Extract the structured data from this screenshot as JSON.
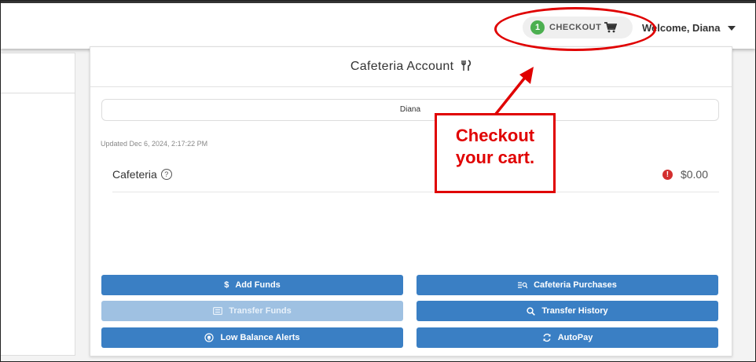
{
  "header": {
    "cart_count": "1",
    "checkout_label": "CHECKOUT",
    "welcome_text": "Welcome, Diana"
  },
  "card": {
    "title": "Cafeteria Account",
    "student_name": "Diana",
    "updated": "Updated Dec 6, 2024, 2:17:22 PM",
    "account": {
      "name": "Cafeteria",
      "help_glyph": "?",
      "alert_glyph": "!",
      "balance": "$0.00"
    },
    "buttons": {
      "add_funds": "Add Funds",
      "cafeteria_purchases": "Cafeteria Purchases",
      "transfer_funds": "Transfer Funds",
      "transfer_history": "Transfer History",
      "low_balance_alerts": "Low Balance Alerts",
      "autopay": "AutoPay"
    }
  },
  "annotation": {
    "callout_line1": "Checkout",
    "callout_line2": "your cart."
  },
  "colors": {
    "primary": "#3a7fc4",
    "primary_disabled": "#9fc1e2",
    "badge": "#4caf50",
    "annotation_red": "#e00000",
    "alert_red": "#d32f2f"
  },
  "icons": [
    "cart-icon",
    "caret-down-icon",
    "fork-knife-icon",
    "help-icon",
    "alert-icon",
    "dollar-icon",
    "receipt-icon",
    "transfer-icon",
    "search-icon",
    "bell-icon",
    "refresh-icon"
  ]
}
